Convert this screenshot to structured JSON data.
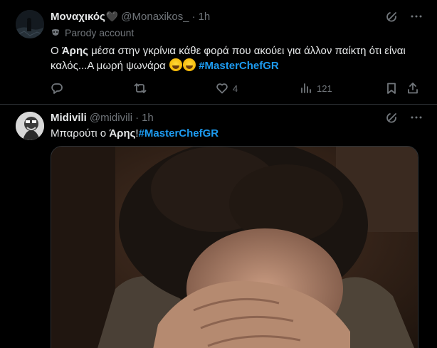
{
  "tweets": [
    {
      "author": {
        "name": "Μοναχικός",
        "name_suffix": "🖤",
        "handle": "@Monaxikos_",
        "time": "1h",
        "parody_label": "Parody account"
      },
      "text": {
        "part1": "Ο ",
        "bold": "Άρης",
        "part2": " μέσα στην γκρίνια κάθε φορά που ακούει για άλλον παίκτη ότι είναι καλός...Α μωρή ψωνάρα ",
        "hashtag": "#MasterChefGR"
      },
      "stats": {
        "replies": "",
        "retweets": "",
        "likes": "4",
        "views": "121"
      }
    },
    {
      "author": {
        "name": "Midivili",
        "handle": "@midivili",
        "time": "1h"
      },
      "text": {
        "part1": "Μπαρούτι ο ",
        "bold": "Άρης",
        "part2": "!",
        "hashtag": "#MasterChefGR"
      }
    }
  ],
  "colors": {
    "background": "#000000",
    "text": "#e7e9ea",
    "secondary": "#71767b",
    "accent": "#1d9bf0",
    "divider": "#2f3336"
  },
  "icons": {
    "grok": "grok-icon",
    "more": "more-icon",
    "reply": "reply-icon",
    "retweet": "retweet-icon",
    "like": "heart-icon",
    "views": "views-icon",
    "bookmark": "bookmark-icon",
    "share": "share-icon",
    "parody": "parody-mask-icon"
  }
}
